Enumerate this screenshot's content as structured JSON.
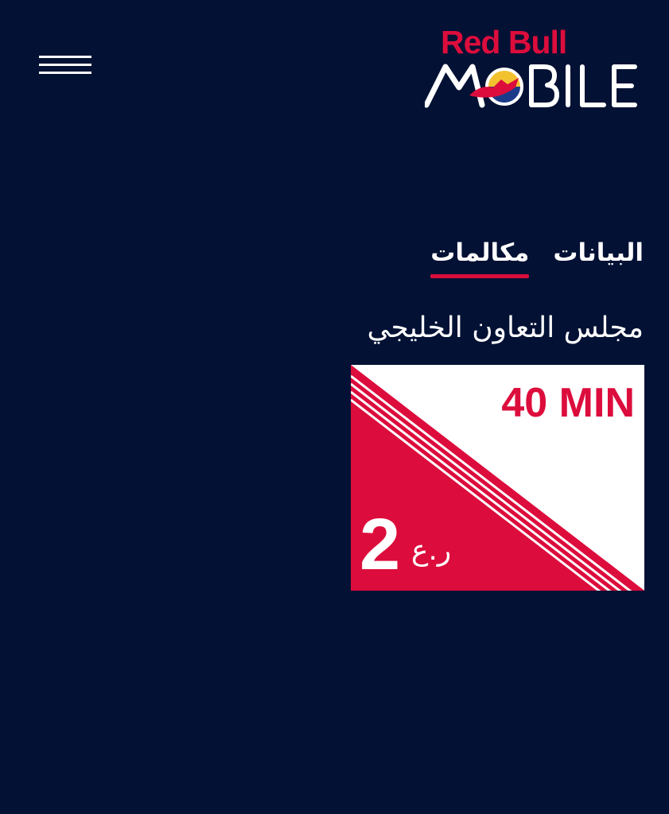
{
  "header": {
    "menu_icon": "hamburger-menu-icon",
    "logo": {
      "brand_text": "Red Bull",
      "sub_text": "MOBILE",
      "colors": {
        "brand": "#dc0d3c",
        "sub": "#ffffff"
      }
    }
  },
  "tabs": [
    {
      "label": "البيانات",
      "active": false
    },
    {
      "label": "مكالمات",
      "active": true
    }
  ],
  "region_title": "مجلس التعاون الخليجي",
  "plan_card": {
    "minutes": "40 MIN",
    "price": "2",
    "currency": "ر.ع"
  },
  "colors": {
    "background": "#021134",
    "accent": "#dc0d3c",
    "text": "#ffffff"
  }
}
